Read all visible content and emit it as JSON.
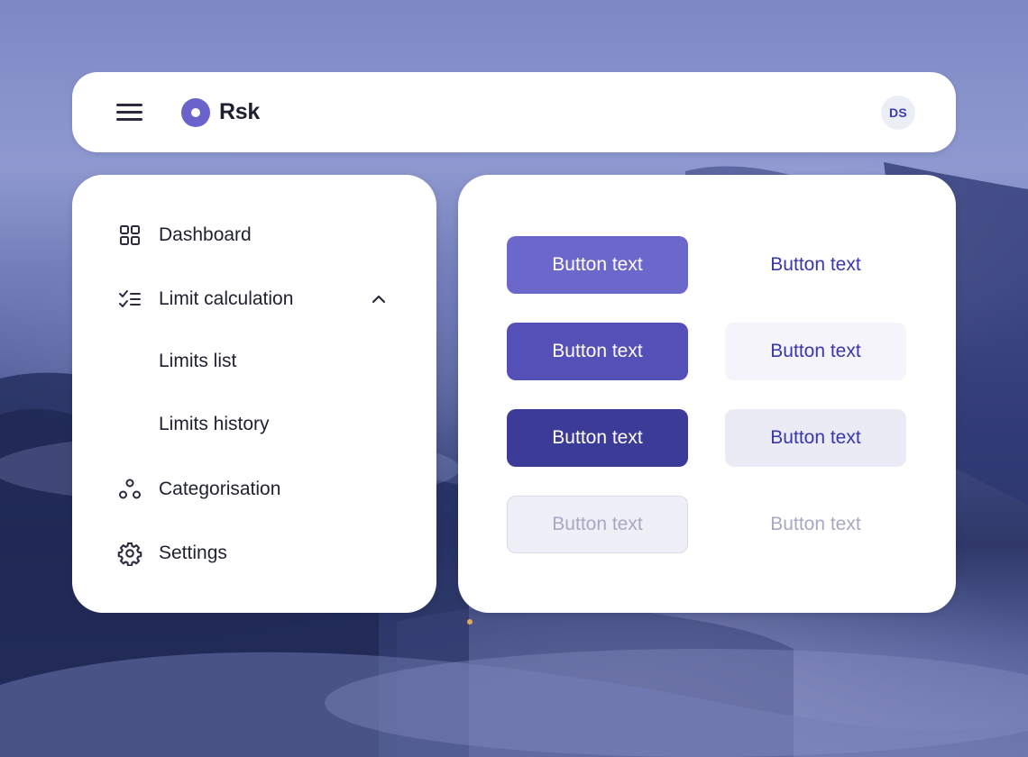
{
  "header": {
    "app_name": "Rsk",
    "avatar_initials": "DS",
    "menu_icon": "hamburger-menu-icon",
    "logo_icon": "ring-logo-icon"
  },
  "sidebar": {
    "items": [
      {
        "label": "Dashboard",
        "icon": "grid-icon"
      },
      {
        "label": "Limit calculation",
        "icon": "checklist-icon",
        "expanded": true,
        "children": [
          {
            "label": "Limits list"
          },
          {
            "label": "Limits history"
          }
        ]
      },
      {
        "label": "Categorisation",
        "icon": "three-circles-icon"
      },
      {
        "label": "Settings",
        "icon": "gear-icon"
      }
    ]
  },
  "buttons": [
    {
      "label": "Button text",
      "variant": "primary-default",
      "state": "enabled"
    },
    {
      "label": "Button text",
      "variant": "text-default",
      "state": "enabled"
    },
    {
      "label": "Button text",
      "variant": "primary-hover",
      "state": "enabled"
    },
    {
      "label": "Button text",
      "variant": "secondary-hover",
      "state": "enabled"
    },
    {
      "label": "Button text",
      "variant": "primary-pressed",
      "state": "enabled"
    },
    {
      "label": "Button text",
      "variant": "secondary-pressed",
      "state": "enabled"
    },
    {
      "label": "Button text",
      "variant": "primary-disabled",
      "state": "disabled"
    },
    {
      "label": "Button text",
      "variant": "text-disabled",
      "state": "disabled"
    }
  ],
  "colors": {
    "brand": "#6b63cc",
    "primary": "#6c68cb",
    "primary_hover": "#5450b8",
    "primary_pressed": "#3d3b98",
    "link_text": "#3a37ad",
    "disabled_text": "#a7a8c2"
  }
}
